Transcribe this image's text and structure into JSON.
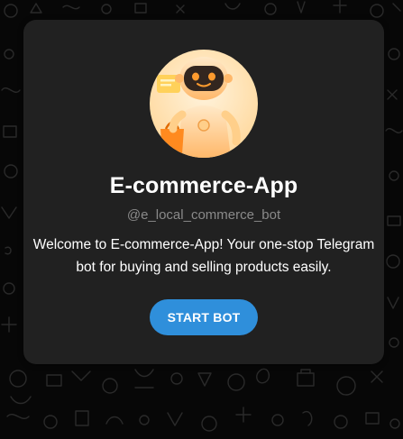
{
  "bot": {
    "name": "E-commerce-App",
    "username": "@e_local_commerce_bot",
    "description": "Welcome to E-commerce-App! Your one-stop Telegram bot for buying and selling products easily.",
    "start_button_label": "START BOT",
    "avatar_icon": "robot-shopping-avatar"
  },
  "colors": {
    "chat_background": "#070707",
    "card_background": "#212121",
    "accent": "#2f8fdb",
    "username_text": "#8a8a8a"
  }
}
